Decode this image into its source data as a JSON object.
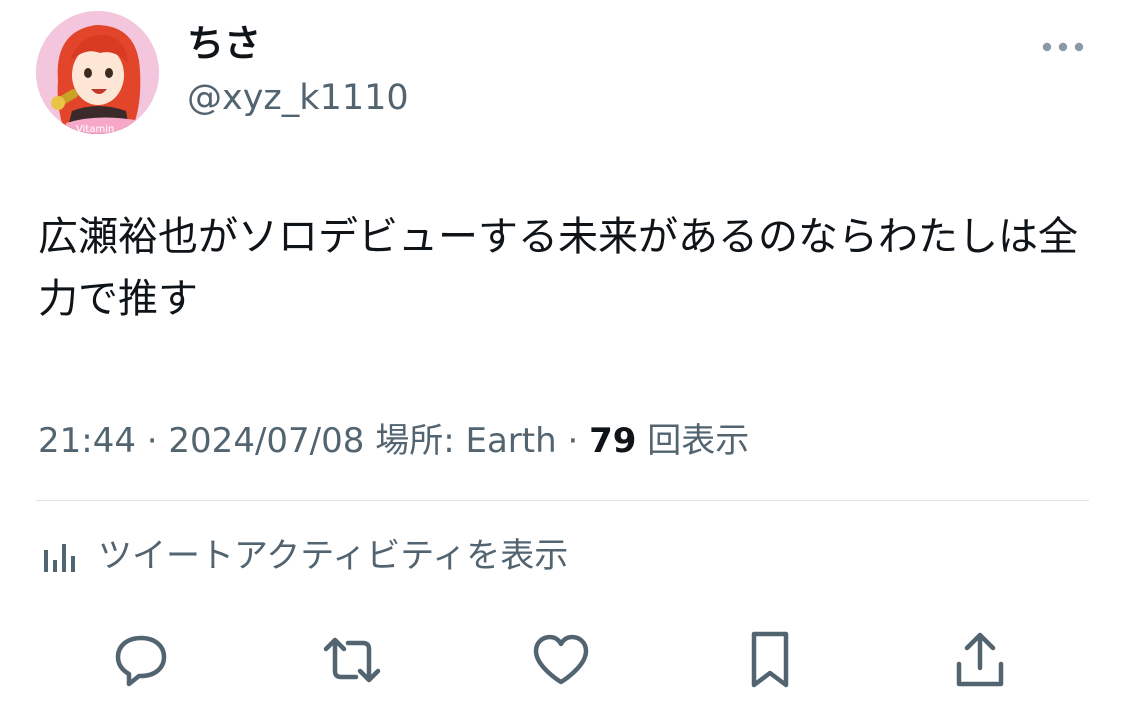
{
  "author": {
    "display_name": "ちさ",
    "handle": "@xyz_k1110",
    "avatar_badge_text": "Vitamin"
  },
  "tweet": {
    "text": "広瀬裕也がソロデビューする未来があるのならわたしは全力で推す",
    "time": "21:44",
    "separator": " · ",
    "date": "2024/07/08",
    "location_prefix": "場所: ",
    "location": "Earth",
    "view_count": "79",
    "view_label": "回表示"
  },
  "activity": {
    "label": "ツイートアクティビティを表示"
  },
  "icons": {
    "more": "more-dots-icon",
    "activity": "bar-chart-icon",
    "reply": "reply-bubble-icon",
    "retweet": "retweet-icon",
    "like": "heart-icon",
    "bookmark": "bookmark-icon",
    "share": "share-upload-icon"
  },
  "colors": {
    "primary_text": "#0f1419",
    "secondary_text": "#536471",
    "divider": "#dfe4e8",
    "avatar_bg": "#f3c6dd",
    "avatar_hair": "#e2452a"
  }
}
